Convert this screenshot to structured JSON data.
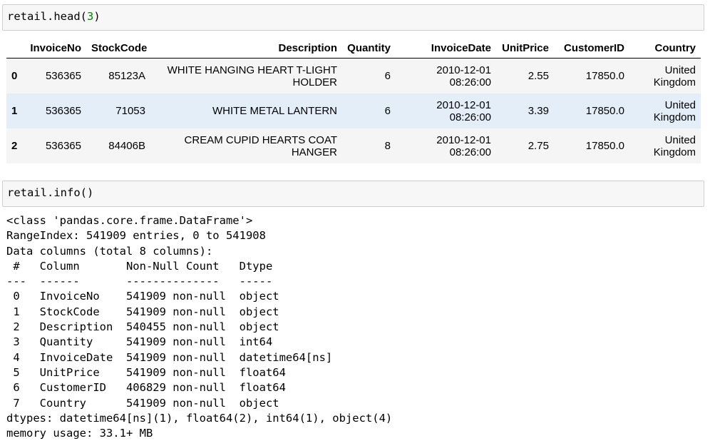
{
  "cell1": {
    "code_prefix": "retail.head(",
    "code_arg": "3",
    "code_suffix": ")"
  },
  "dataframe": {
    "columns": [
      "",
      "InvoiceNo",
      "StockCode",
      "Description",
      "Quantity",
      "InvoiceDate",
      "UnitPrice",
      "CustomerID",
      "Country"
    ],
    "rows": [
      {
        "index": "0",
        "InvoiceNo": "536365",
        "StockCode": "85123A",
        "Description": "WHITE HANGING HEART T-LIGHT HOLDER",
        "Quantity": "6",
        "InvoiceDate": "2010-12-01 08:26:00",
        "UnitPrice": "2.55",
        "CustomerID": "17850.0",
        "Country": "United Kingdom"
      },
      {
        "index": "1",
        "InvoiceNo": "536365",
        "StockCode": "71053",
        "Description": "WHITE METAL LANTERN",
        "Quantity": "6",
        "InvoiceDate": "2010-12-01 08:26:00",
        "UnitPrice": "3.39",
        "CustomerID": "17850.0",
        "Country": "United Kingdom"
      },
      {
        "index": "2",
        "InvoiceNo": "536365",
        "StockCode": "84406B",
        "Description": "CREAM CUPID HEARTS COAT HANGER",
        "Quantity": "8",
        "InvoiceDate": "2010-12-01 08:26:00",
        "UnitPrice": "2.75",
        "CustomerID": "17850.0",
        "Country": "United Kingdom"
      }
    ]
  },
  "cell2": {
    "code": "retail.info()"
  },
  "info_output": {
    "text": "<class 'pandas.core.frame.DataFrame'>\nRangeIndex: 541909 entries, 0 to 541908\nData columns (total 8 columns):\n #   Column       Non-Null Count   Dtype         \n---  ------       --------------   -----         \n 0   InvoiceNo    541909 non-null  object        \n 1   StockCode    541909 non-null  object        \n 2   Description  540455 non-null  object        \n 3   Quantity     541909 non-null  int64         \n 4   InvoiceDate  541909 non-null  datetime64[ns]\n 5   UnitPrice    541909 non-null  float64       \n 6   CustomerID   406829 non-null  float64       \n 7   Country      541909 non-null  object        \ndtypes: datetime64[ns](1), float64(2), int64(1), object(4)\nmemory usage: 33.1+ MB"
  }
}
